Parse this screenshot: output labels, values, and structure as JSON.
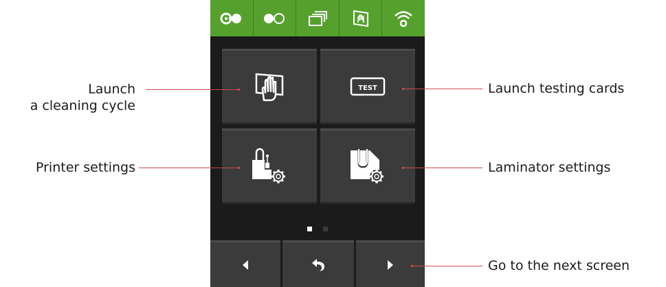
{
  "annotations": {
    "cleaning": {
      "line1": "Launch",
      "line2": "a cleaning cycle"
    },
    "printer_settings": "Printer settings",
    "testing_cards": "Launch testing cards",
    "laminator_settings": "Laminator settings",
    "next_screen": "Go to the next screen"
  },
  "status_bar": {
    "icons": [
      "ribbon-icon",
      "film-icon",
      "card-stack-icon",
      "cleaning-card-icon",
      "wifi-icon"
    ]
  },
  "tiles": {
    "cleaning": "cleaning-icon",
    "test": {
      "icon": "test-card-icon",
      "label": "TEST"
    },
    "printer_settings": "printer-settings-icon",
    "laminator_settings": "laminator-settings-icon"
  },
  "pager": {
    "pages": 2,
    "current": 1
  },
  "navigation": [
    "previous-icon",
    "back-icon",
    "next-icon"
  ],
  "colors": {
    "status_bar": "#56a12e",
    "screen_background": "#1b1b1b",
    "button": "#3b3b3b",
    "leader_line": "#c94a4a"
  }
}
